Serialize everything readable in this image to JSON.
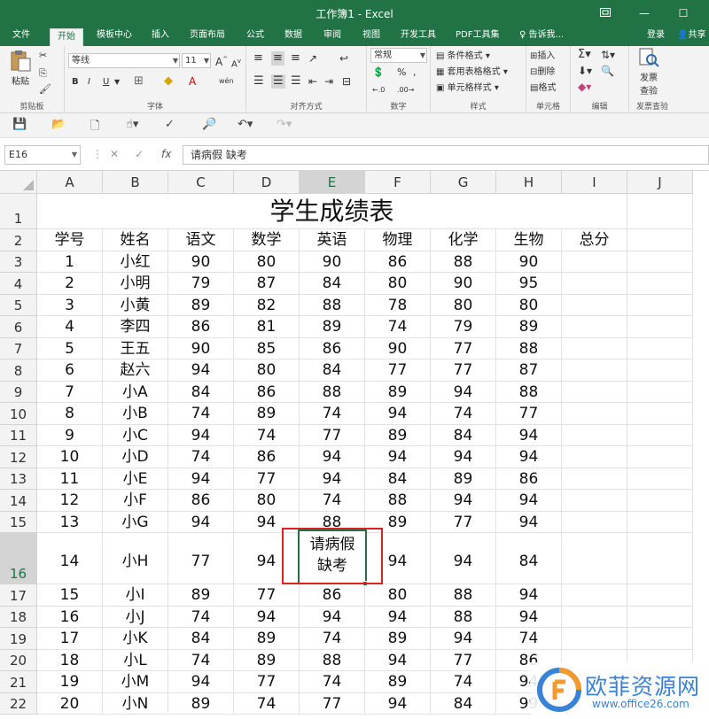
{
  "window": {
    "title": "工作簿1 - Excel",
    "restore_icon": "restore-window-icon",
    "minimize": "—",
    "maximize": "☐",
    "colors": {
      "accent": "#217346",
      "selection_highlight": "#e0201e"
    }
  },
  "tabs": [
    {
      "label": "文件",
      "active": false
    },
    {
      "label": "开始",
      "active": true
    },
    {
      "label": "模板中心",
      "active": false
    },
    {
      "label": "插入",
      "active": false
    },
    {
      "label": "页面布局",
      "active": false
    },
    {
      "label": "公式",
      "active": false
    },
    {
      "label": "数据",
      "active": false
    },
    {
      "label": "审阅",
      "active": false
    },
    {
      "label": "视图",
      "active": false
    },
    {
      "label": "开发工具",
      "active": false
    },
    {
      "label": "PDF工具集",
      "active": false
    }
  ],
  "tell_me": "告诉我...",
  "login": "登录",
  "share": "共享",
  "ribbon": {
    "clipboard": {
      "label": "剪贴板",
      "paste": "粘贴"
    },
    "font": {
      "label": "字体",
      "name": "等线",
      "size": "11",
      "bold": "B",
      "italic": "I",
      "underline": "U",
      "grow": "A",
      "shrink": "A",
      "phonetic": "wén"
    },
    "alignment": {
      "label": "对齐方式"
    },
    "number": {
      "label": "数字",
      "format": "常规"
    },
    "styles": {
      "label": "样式",
      "conditional": "条件格式",
      "table": "套用表格格式",
      "cell": "单元格样式"
    },
    "cells": {
      "label": "单元格",
      "insert": "插入",
      "delete": "删除",
      "format": "格式"
    },
    "editing": {
      "label": "编辑"
    },
    "invoice": {
      "label": "发票查验",
      "button_line1": "发票",
      "button_line2": "查验"
    }
  },
  "formula_bar": {
    "name_box": "E16",
    "fx": "fx",
    "content": "请病假 缺考"
  },
  "columns": [
    "A",
    "B",
    "C",
    "D",
    "E",
    "F",
    "G",
    "H",
    "I",
    "J"
  ],
  "sheet": {
    "title": "学生成绩表",
    "headers": [
      "学号",
      "姓名",
      "语文",
      "数学",
      "英语",
      "物理",
      "化学",
      "生物",
      "总分"
    ],
    "rows": [
      [
        "1",
        "小红",
        "90",
        "80",
        "90",
        "86",
        "88",
        "90"
      ],
      [
        "2",
        "小明",
        "79",
        "87",
        "84",
        "80",
        "90",
        "95"
      ],
      [
        "3",
        "小黄",
        "89",
        "82",
        "88",
        "78",
        "80",
        "80"
      ],
      [
        "4",
        "李四",
        "86",
        "81",
        "89",
        "74",
        "79",
        "89"
      ],
      [
        "5",
        "王五",
        "90",
        "85",
        "86",
        "90",
        "77",
        "88"
      ],
      [
        "6",
        "赵六",
        "94",
        "80",
        "84",
        "77",
        "77",
        "87"
      ],
      [
        "7",
        "小A",
        "84",
        "86",
        "88",
        "89",
        "94",
        "88"
      ],
      [
        "8",
        "小B",
        "74",
        "89",
        "74",
        "94",
        "74",
        "77"
      ],
      [
        "9",
        "小C",
        "94",
        "74",
        "77",
        "89",
        "84",
        "94"
      ],
      [
        "10",
        "小D",
        "74",
        "86",
        "94",
        "94",
        "94",
        "94"
      ],
      [
        "11",
        "小E",
        "94",
        "77",
        "94",
        "84",
        "89",
        "86"
      ],
      [
        "12",
        "小F",
        "86",
        "80",
        "74",
        "88",
        "94",
        "94"
      ],
      [
        "13",
        "小G",
        "94",
        "94",
        "88",
        "89",
        "77",
        "94"
      ],
      [
        "14",
        "小H",
        "77",
        "94",
        "请病假\n缺考",
        "94",
        "94",
        "84"
      ],
      [
        "15",
        "小I",
        "89",
        "77",
        "86",
        "80",
        "88",
        "94"
      ],
      [
        "16",
        "小J",
        "74",
        "94",
        "94",
        "94",
        "88",
        "94"
      ],
      [
        "17",
        "小K",
        "84",
        "89",
        "74",
        "89",
        "94",
        "74"
      ],
      [
        "18",
        "小L",
        "74",
        "89",
        "88",
        "94",
        "77",
        "86"
      ],
      [
        "19",
        "小M",
        "94",
        "77",
        "74",
        "89",
        "74",
        "94"
      ],
      [
        "20",
        "小N",
        "89",
        "74",
        "77",
        "94",
        "84",
        "99"
      ]
    ]
  },
  "watermark": {
    "brand": "欧菲资源网",
    "url": "www.office26.com"
  }
}
